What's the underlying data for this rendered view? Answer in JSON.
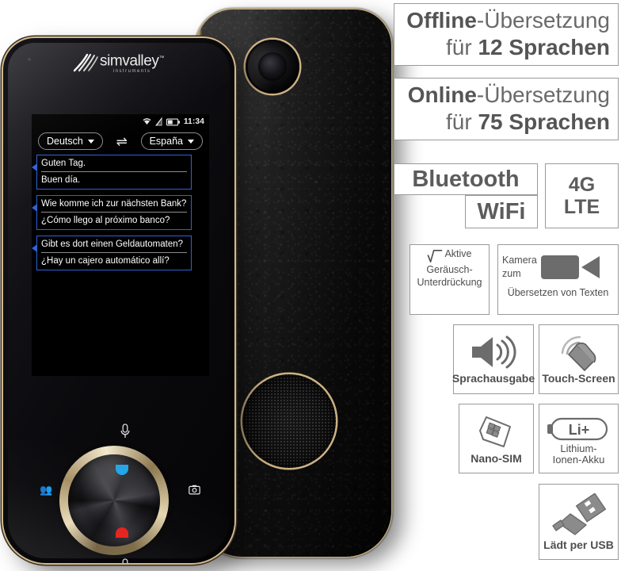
{
  "product": {
    "brand": {
      "name": "simvalley",
      "trademark": "™",
      "sub": "instruments"
    },
    "phone_screen": {
      "status_bar": {
        "time": "11:34",
        "icons": [
          "wifi-icon",
          "signal-icon",
          "battery-icon"
        ]
      },
      "language_from": "Deutsch",
      "language_to": "España",
      "swap_icon": "⇌",
      "conversation": [
        {
          "source": "Guten Tag.",
          "target": "Buen día."
        },
        {
          "source": "Wie komme ich zur nächsten Bank?",
          "target": "¿Cómo llego al próximo banco?"
        },
        {
          "source": "Gibt es dort einen Geldautomaten?",
          "target": "¿Hay un cajero automático allí?"
        }
      ],
      "dial": {
        "record_indicator": "#e41f18",
        "play_indicator": "#23a7e8"
      }
    },
    "colors": {
      "gold_trim": "#cdb184",
      "accent_blue": "#2f62d8",
      "text_gray": "#5c5c5c"
    }
  },
  "features": {
    "offline": {
      "strong": "Offline",
      "rest": "-Übersetzung",
      "line2_pre": "für ",
      "line2_strong": "12 Sprachen"
    },
    "online": {
      "strong": "Online",
      "rest": "-Übersetzung",
      "line2_pre": "für ",
      "line2_strong": "75 Sprachen"
    },
    "bluetooth": "Bluetooth",
    "wifi": "WiFi",
    "lte_line1": "4G",
    "lte_line2": "LTE",
    "noise": {
      "line1": "Aktive",
      "line2": "Geräusch-",
      "line3": "Unterdrückung",
      "icon": "waveform-icon"
    },
    "camera": {
      "line1": "Kamera",
      "line2": "zum",
      "line3": "Übersetzen von Texten",
      "icon": "video-camera-icon"
    },
    "speech": {
      "label": "Sprachausgabe",
      "icon": "speaker-icon"
    },
    "touch": {
      "label": "Touch-Screen",
      "icon": "touch-finger-icon"
    },
    "sim": {
      "label": "Nano-SIM",
      "icon": "sim-card-icon"
    },
    "battery": {
      "badge": "Li+",
      "line1": "Lithium-",
      "line2": "Ionen-Akku",
      "icon": "battery-pill-icon"
    },
    "usb": {
      "label": "Lädt per USB",
      "icon": "usb-plug-icon"
    }
  }
}
